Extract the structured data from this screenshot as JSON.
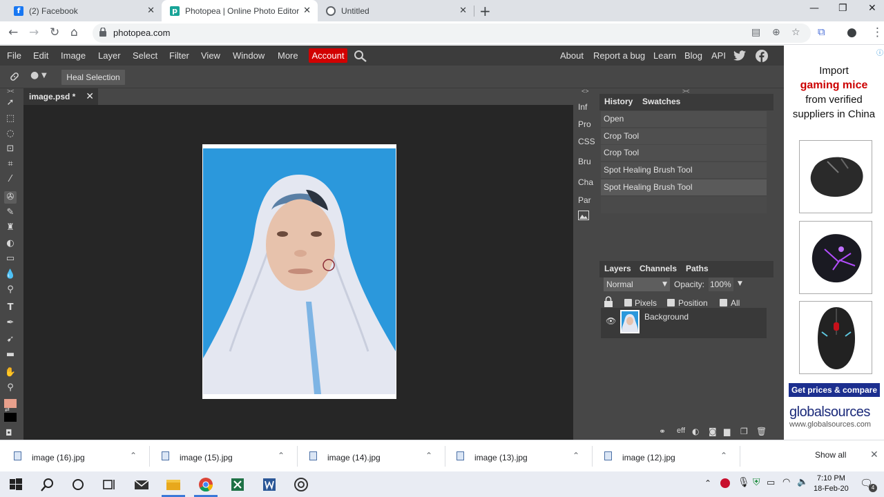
{
  "browser": {
    "tabs": [
      {
        "title": "(2) Facebook",
        "favicon": "facebook-icon",
        "color": "#1877f2"
      },
      {
        "title": "Photopea | Online Photo Editor",
        "favicon": "photopea-icon",
        "color": "#18a497"
      },
      {
        "title": "Untitled",
        "favicon": "globe-icon",
        "color": "#5f6368"
      }
    ],
    "url": "photopea.com"
  },
  "photopea": {
    "menu": [
      "File",
      "Edit",
      "Image",
      "Layer",
      "Select",
      "Filter",
      "View",
      "Window",
      "More"
    ],
    "account_label": "Account",
    "right_menu": [
      "About",
      "Report a bug",
      "Learn",
      "Blog",
      "API"
    ],
    "options": {
      "heal_selection": "Heal Selection"
    },
    "document_tab": "image.psd *",
    "side_panels": [
      "Inf",
      "Pro",
      "CSS",
      "Bru",
      "Cha",
      "Par"
    ],
    "history": {
      "tabs": [
        "History",
        "Swatches"
      ],
      "items": [
        "Open",
        "Crop Tool",
        "Crop Tool",
        "Spot Healing Brush Tool",
        "Spot Healing Brush Tool"
      ]
    },
    "layers": {
      "tabs": [
        "Layers",
        "Channels",
        "Paths"
      ],
      "blend_mode": "Normal",
      "opacity_label": "Opacity:",
      "opacity_value": "100%",
      "lock_options": [
        "Pixels",
        "Position",
        "All"
      ],
      "layer_name": "Background",
      "footer_eff": "eff"
    },
    "accent": "#d10000"
  },
  "ad": {
    "line1": "Import",
    "line2": "gaming mice",
    "line3": "from verified",
    "line4": "suppliers in China",
    "button": "Get prices & compare",
    "brand": "globalsources",
    "brand_url": "www.globalsources.com"
  },
  "downloads": {
    "files": [
      "image (16).jpg",
      "image (15).jpg",
      "image (14).jpg",
      "image (13).jpg",
      "image (12).jpg"
    ],
    "show_all": "Show all"
  },
  "taskbar": {
    "time": "7:10 PM",
    "date": "18-Feb-20",
    "notifications": "4"
  }
}
